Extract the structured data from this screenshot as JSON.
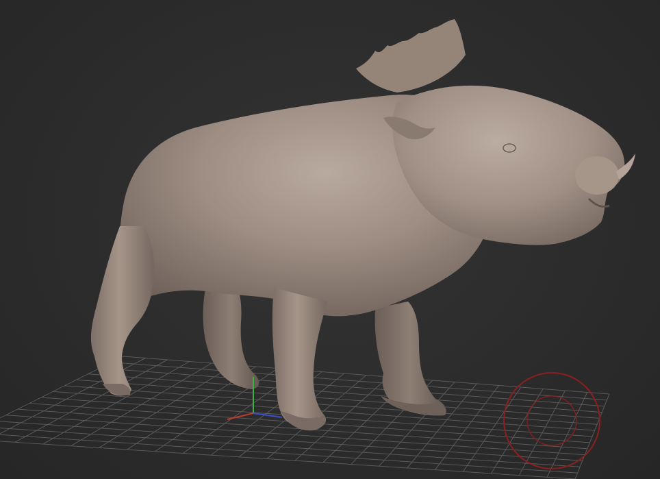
{
  "viewport": {
    "background_color": "#2b2b2b",
    "model": {
      "subject": "boar sculpt",
      "material_color": "#9a8a80",
      "shadow_color": "#5e524b",
      "highlight_color": "#c2b3a8"
    },
    "floor_grid": {
      "visible": true,
      "line_color": "#5a5a5a"
    },
    "axis_gizmo": {
      "icon": "xyz-axis-icon",
      "x_color": "#c0392b",
      "y_color": "#3cb043",
      "z_color": "#3a4fd0"
    },
    "rotation_indicator": {
      "icon": "rotate-circle-icon",
      "color": "#8e1f1f"
    }
  }
}
